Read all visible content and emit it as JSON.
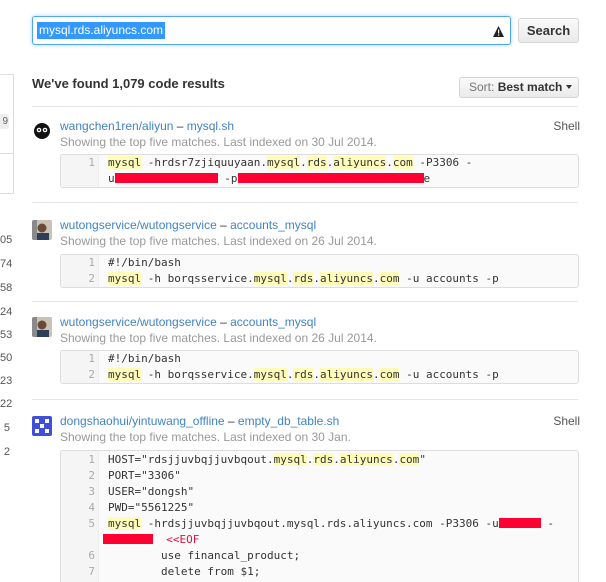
{
  "search": {
    "query": "mysql.rds.aliyuncs.com",
    "button_label": "Search"
  },
  "results": {
    "heading": "We've found 1,079 code results",
    "sort_label": "Sort:",
    "sort_value": "Best match"
  },
  "sidebar": {
    "counts": [
      "9",
      "05",
      "74",
      "58",
      "24",
      "53",
      "50",
      "23",
      "22",
      "5",
      "2"
    ]
  },
  "items": [
    {
      "repo": "wangchen1ren/aliyun",
      "dash": " – ",
      "file": "mysql.sh",
      "meta": "Showing the top five matches. Last indexed on 30 Jul 2014.",
      "lang": "Shell",
      "lines": [
        {
          "n": "1",
          "segs": [
            "mysql",
            " -hrdsr7zjiquuyaan.",
            "mysql",
            ".",
            "rds",
            ".",
            "aliyuncs",
            ".",
            "com",
            " -P3306 -"
          ]
        },
        {
          "n": "",
          "segs": [
            "u",
            " -p",
            "e"
          ]
        }
      ]
    },
    {
      "repo": "wutongservice/wutongservice",
      "dash": " – ",
      "file": "accounts_mysql",
      "meta": "Showing the top five matches. Last indexed on 26 Jul 2014.",
      "lines": [
        {
          "n": "1",
          "segs": [
            "#!/bin/bash"
          ]
        },
        {
          "n": "2",
          "segs": [
            "mysql",
            " -h borqsservice.",
            "mysql",
            ".",
            "rds",
            ".",
            "aliyuncs",
            ".",
            "com",
            " -u accounts -p"
          ]
        }
      ]
    },
    {
      "repo": "wutongservice/wutongservice",
      "dash": " – ",
      "file": "accounts_mysql",
      "meta": "Showing the top five matches. Last indexed on 26 Jul 2014.",
      "lines": [
        {
          "n": "1",
          "segs": [
            "#!/bin/bash"
          ]
        },
        {
          "n": "2",
          "segs": [
            "mysql",
            " -h borqsservice.",
            "mysql",
            ".",
            "rds",
            ".",
            "aliyuncs",
            ".",
            "com",
            " -u accounts -p"
          ]
        }
      ]
    },
    {
      "repo": "dongshaohui/yintuwang_offline",
      "dash": " – ",
      "file": "empty_db_table.sh",
      "meta": "Showing the top five matches. Last indexed on 30 Jan.",
      "lang": "Shell",
      "lines": [
        {
          "n": "1",
          "segs": [
            "HOST=\"rdsjjuvbqjjuvbqout.",
            "mysql",
            ".",
            "rds",
            ".",
            "aliyuncs",
            ".",
            "com",
            "\""
          ]
        },
        {
          "n": "2",
          "segs": [
            "PORT=\"3306\""
          ]
        },
        {
          "n": "3",
          "segs": [
            "USER=\"dongsh\""
          ]
        },
        {
          "n": "4",
          "segs": [
            "PWD=\"5561225\""
          ]
        },
        {
          "n": "5",
          "segs": [
            "mysql",
            " -hrdsjjuvbqjjuvbqout.mysql.rds.aliyuncs.com -P3306 -u",
            " -"
          ]
        },
        {
          "n": "6",
          "segs": [
            "<<EOF"
          ]
        },
        {
          "n": "6",
          "segs": [
            "use financal_product;"
          ]
        },
        {
          "n": "7",
          "segs": [
            "delete from $1;"
          ]
        }
      ]
    }
  ]
}
